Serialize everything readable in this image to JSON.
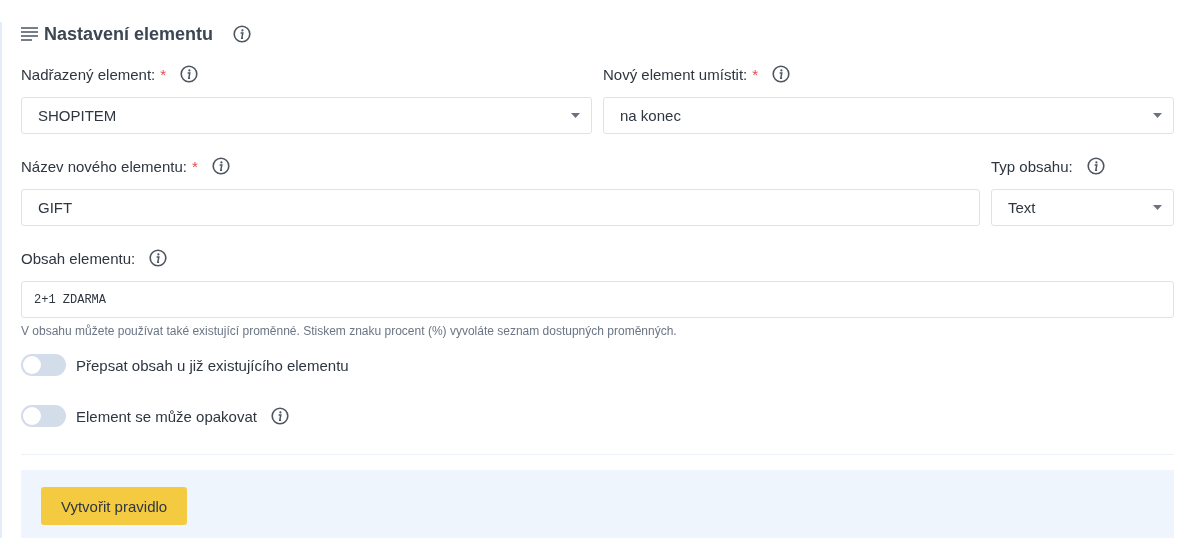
{
  "section": {
    "title": "Nastavení elementu",
    "info": true
  },
  "rows": [
    [
      {
        "label": "Nadřazený element:",
        "required_mark": "*",
        "info": true,
        "kind": "select",
        "value": "SHOPITEM"
      },
      {
        "label": "Nový element umístit:",
        "required_mark": "*",
        "info": true,
        "kind": "select",
        "value": "na konec"
      }
    ],
    [
      {
        "label": "Název nového elementu:",
        "required_mark": "*",
        "info": true,
        "kind": "text",
        "value": "GIFT"
      },
      {
        "label": "Typ obsahu:",
        "info": true,
        "kind": "select",
        "value": "Text"
      }
    ],
    [
      {
        "label": "Obsah elementu:",
        "info": true,
        "kind": "code",
        "value": "2+1 ZDARMA",
        "help": "V obsahu můžete používat také existující proměnné. Stiskem znaku procent (%) vyvoláte seznam dostupných proměnných."
      }
    ]
  ],
  "toggles": [
    {
      "label": "Přepsat obsah u již existujícího elementu",
      "on": false,
      "info": false
    },
    {
      "label": "Element se může opakovat",
      "on": false,
      "info": true
    }
  ],
  "submit": "Vytvořit pravidlo"
}
